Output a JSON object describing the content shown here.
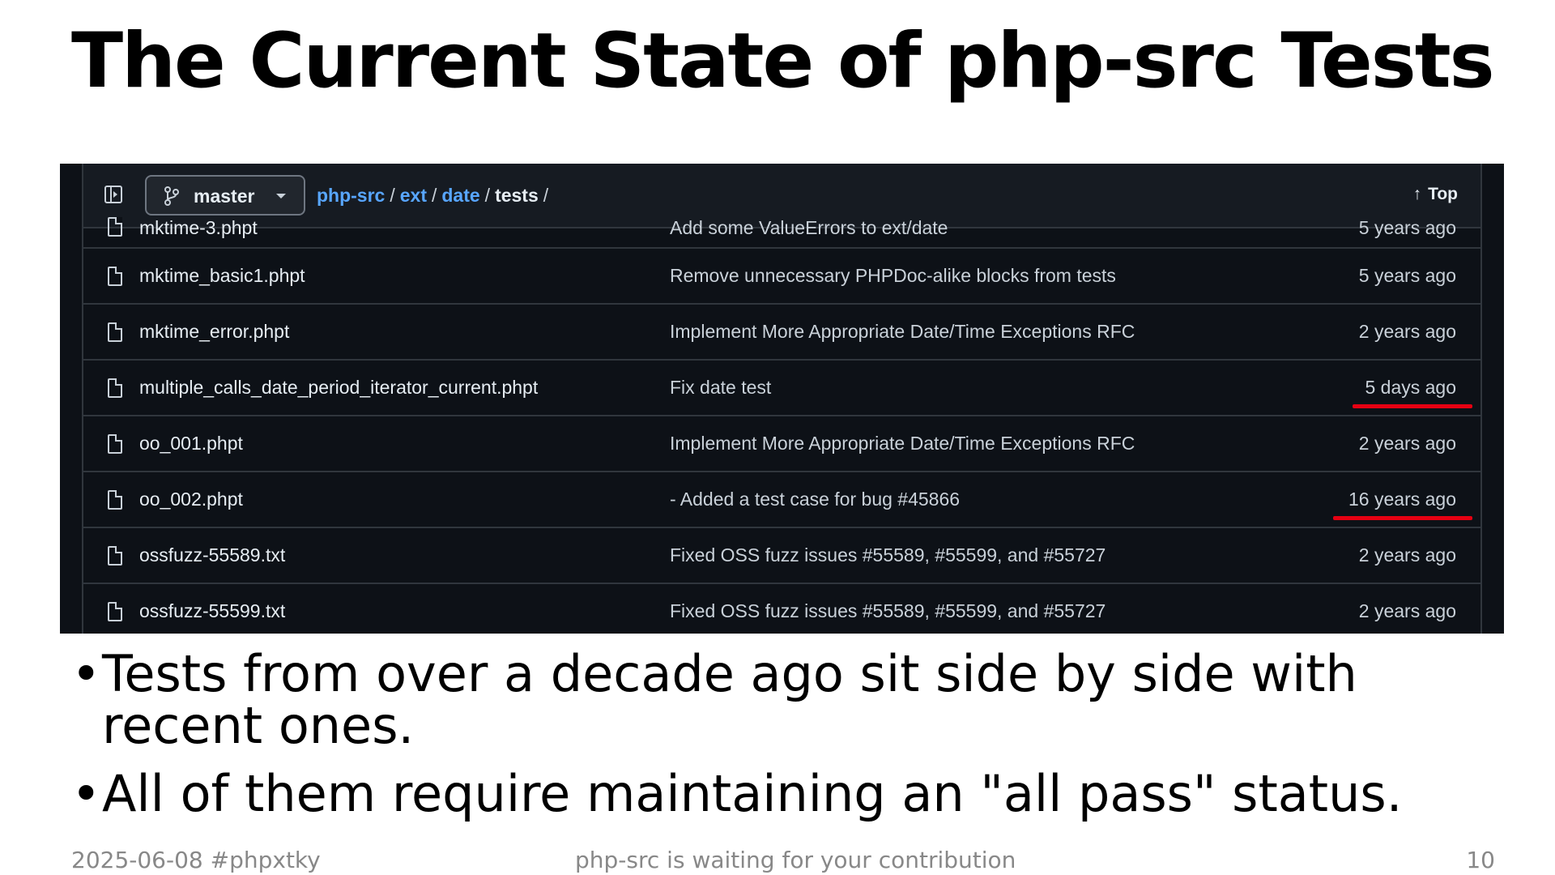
{
  "slide": {
    "title": "The Current State of php-src Tests",
    "bullets": [
      "Tests from over a decade ago sit side by side with recent ones.",
      "All of them require maintaining an \"all pass\" status."
    ],
    "footer": {
      "left": "2025-06-08 #phpxtky",
      "center": "php-src is waiting for your contribution",
      "page": "10"
    }
  },
  "github": {
    "branch": "master",
    "breadcrumb": {
      "repo": "php-src",
      "dir1": "ext",
      "dir2": "date",
      "current": "tests",
      "sep": "/"
    },
    "top_label": "Top",
    "top_arrow": "↑",
    "rows": [
      {
        "name": "mktime-3.phpt",
        "commit": "Add some ValueErrors to ext/date",
        "age": "5 years ago"
      },
      {
        "name": "mktime_basic1.phpt",
        "commit": "Remove unnecessary PHPDoc-alike blocks from tests",
        "age": "5 years ago"
      },
      {
        "name": "mktime_error.phpt",
        "commit": "Implement More Appropriate Date/Time Exceptions RFC",
        "age": "2 years ago"
      },
      {
        "name": "multiple_calls_date_period_iterator_current.phpt",
        "commit": "Fix date test",
        "age": "5 days ago"
      },
      {
        "name": "oo_001.phpt",
        "commit": "Implement More Appropriate Date/Time Exceptions RFC",
        "age": "2 years ago"
      },
      {
        "name": "oo_002.phpt",
        "commit": "- Added a test case for bug #45866",
        "age": "16 years ago"
      },
      {
        "name": "ossfuzz-55589.txt",
        "commit": "Fixed OSS fuzz issues #55589, #55599, and #55727",
        "age": "2 years ago"
      },
      {
        "name": "ossfuzz-55599.txt",
        "commit": "Fixed OSS fuzz issues #55589, #55599, and #55727",
        "age": "2 years ago"
      }
    ],
    "highlight_color": "#e60012"
  }
}
